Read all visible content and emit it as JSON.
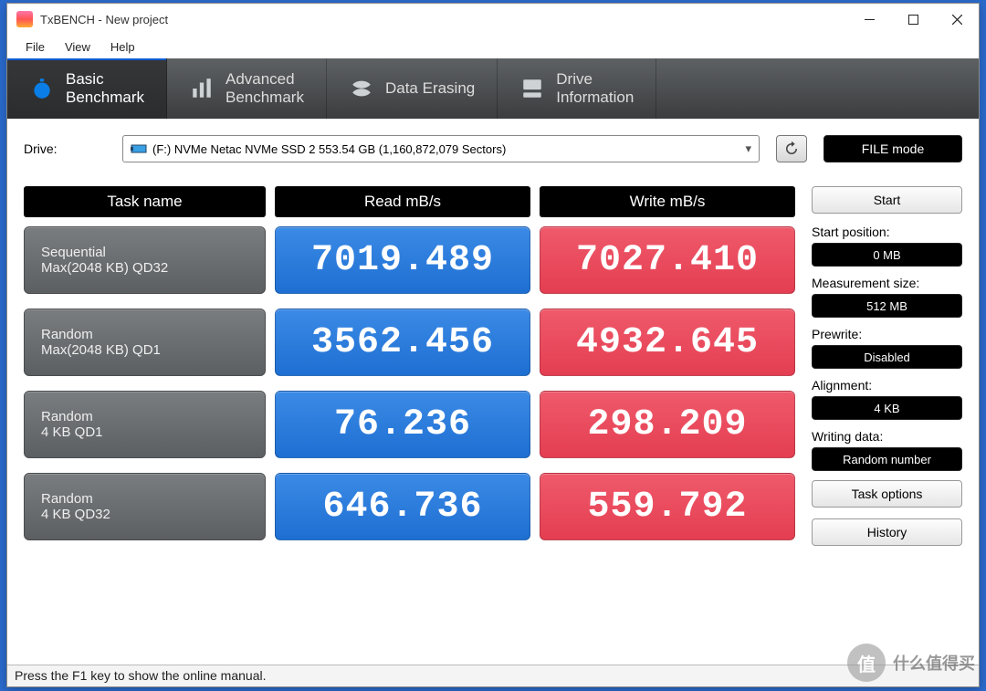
{
  "window": {
    "title": "TxBENCH - New project"
  },
  "menu": {
    "file": "File",
    "view": "View",
    "help": "Help"
  },
  "tabs": {
    "basic": {
      "l1": "Basic",
      "l2": "Benchmark"
    },
    "advanced": {
      "l1": "Advanced",
      "l2": "Benchmark"
    },
    "erase": {
      "l1": "Data Erasing"
    },
    "info": {
      "l1": "Drive",
      "l2": "Information"
    }
  },
  "drive": {
    "label": "Drive:",
    "selected": "(F:) NVMe Netac NVMe SSD 2  553.54 GB (1,160,872,079 Sectors)"
  },
  "file_mode": "FILE mode",
  "headers": {
    "task": "Task name",
    "read": "Read mB/s",
    "write": "Write mB/s"
  },
  "results": [
    {
      "task_l1": "Sequential",
      "task_l2": "Max(2048 KB) QD32",
      "read": "7019.489",
      "write": "7027.410"
    },
    {
      "task_l1": "Random",
      "task_l2": "Max(2048 KB) QD1",
      "read": "3562.456",
      "write": "4932.645"
    },
    {
      "task_l1": "Random",
      "task_l2": "4 KB QD1",
      "read": "76.236",
      "write": "298.209"
    },
    {
      "task_l1": "Random",
      "task_l2": "4 KB QD32",
      "read": "646.736",
      "write": "559.792"
    }
  ],
  "side": {
    "start": "Start",
    "start_pos_label": "Start position:",
    "start_pos_val": "0 MB",
    "meas_label": "Measurement size:",
    "meas_val": "512 MB",
    "prewrite_label": "Prewrite:",
    "prewrite_val": "Disabled",
    "align_label": "Alignment:",
    "align_val": "4 KB",
    "writing_label": "Writing data:",
    "writing_val": "Random number",
    "task_options": "Task options",
    "history": "History"
  },
  "status": "Press the F1 key to show the online manual.",
  "watermark": {
    "badge": "值",
    "text": "什么值得买"
  }
}
